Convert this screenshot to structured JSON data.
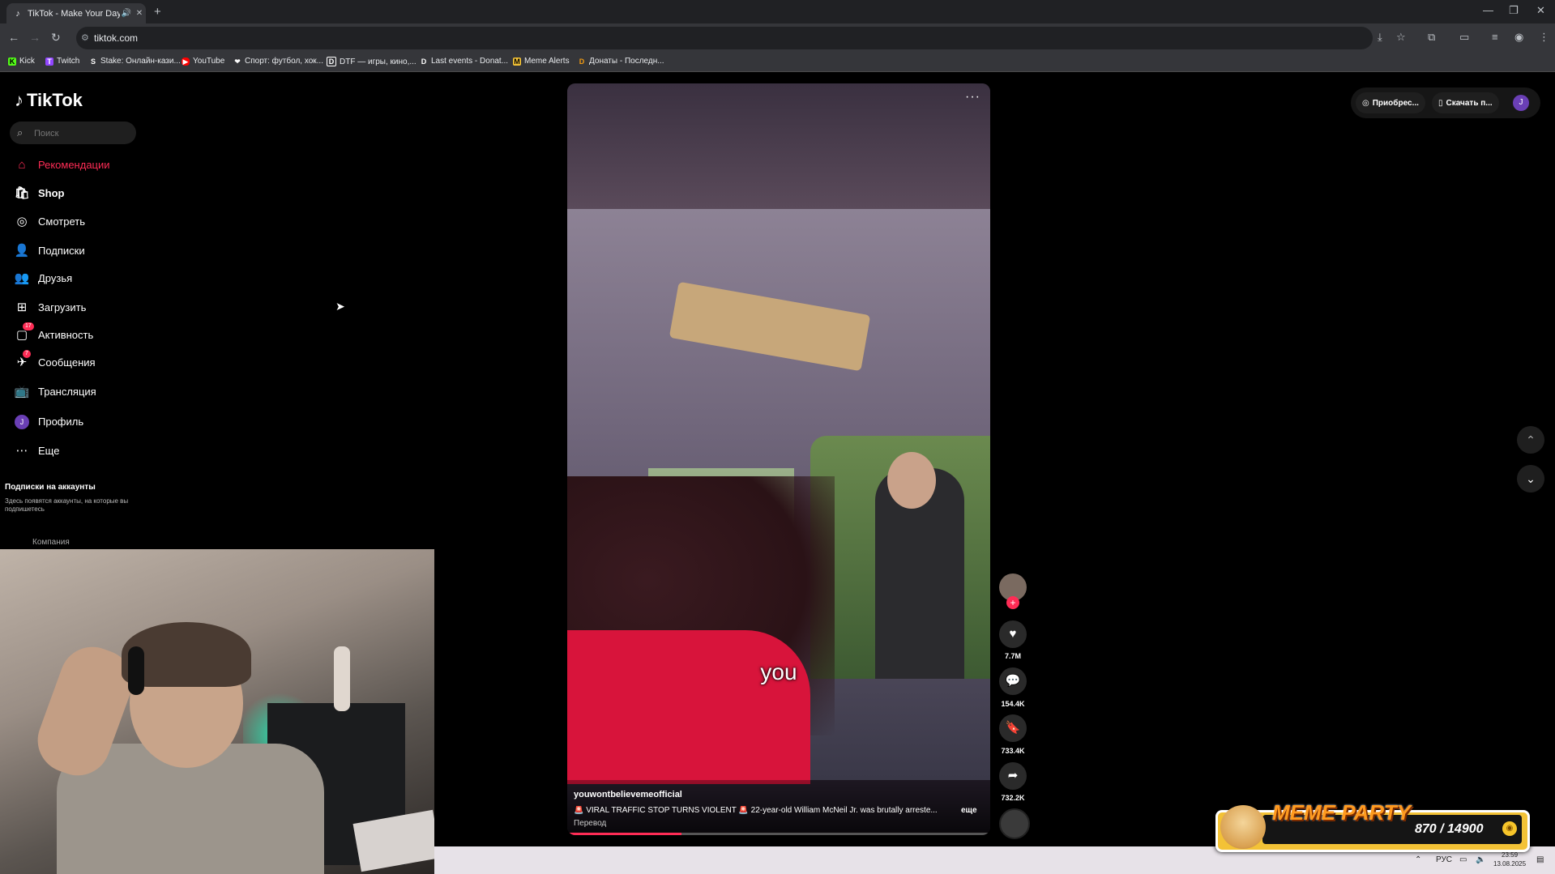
{
  "browser": {
    "tab_title": "TikTok - Make Your Day",
    "url": "tiktok.com",
    "bookmarks": [
      {
        "label": "Kick",
        "icon": "kick-icon",
        "color": "#53fc18"
      },
      {
        "label": "Twitch",
        "icon": "twitch-icon",
        "color": "#9146ff"
      },
      {
        "label": "Stake: Онлайн-кази...",
        "icon": "stake-icon",
        "color": "#ffffff"
      },
      {
        "label": "YouTube",
        "icon": "youtube-icon",
        "color": "#ff0000"
      },
      {
        "label": "Спорт: футбол, хок...",
        "icon": "sport-icon",
        "color": "#ffffff"
      },
      {
        "label": "DTF — игры, кино,...",
        "icon": "dtf-icon",
        "color": "#ffffff"
      },
      {
        "label": "Last events - Donat...",
        "icon": "donat-icon",
        "color": "#ffffff"
      },
      {
        "label": "Meme Alerts",
        "icon": "meme-alerts-icon",
        "color": "#f3c236"
      },
      {
        "label": "Донаты - Последн...",
        "icon": "donate-icon",
        "color": "#f39c12"
      }
    ]
  },
  "tiktok": {
    "logo": "TikTok",
    "search_placeholder": "Поиск",
    "nav": [
      {
        "label": "Рекомендации",
        "icon": "home-icon",
        "active": true
      },
      {
        "label": "Shop",
        "icon": "shop-icon"
      },
      {
        "label": "Смотреть",
        "icon": "explore-icon"
      },
      {
        "label": "Подписки",
        "icon": "following-icon"
      },
      {
        "label": "Друзья",
        "icon": "friends-icon"
      },
      {
        "label": "Загрузить",
        "icon": "upload-icon"
      },
      {
        "label": "Активность",
        "icon": "activity-icon",
        "badge": "17"
      },
      {
        "label": "Сообщения",
        "icon": "messages-icon",
        "badge": "7"
      },
      {
        "label": "Трансляция",
        "icon": "live-icon"
      },
      {
        "label": "Профиль",
        "icon": "profile-avatar",
        "avatar": "J"
      },
      {
        "label": "Еще",
        "icon": "more-icon"
      }
    ],
    "following_header": "Подписки на аккаунты",
    "following_subtext": "Здесь появятся аккаунты, на которые вы подпишетесь",
    "company": "Компания",
    "top_buttons": {
      "get_coins": "Приобрес...",
      "download": "Скачать п...",
      "user_initial": "J"
    }
  },
  "video": {
    "subtitle": "you",
    "author": "youwontbelievemeofficial",
    "caption": "🚨 VIRAL TRAFFIC STOP TURNS VIOLENT 🚨 22-year-old William McNeil Jr. was brutally arreste...",
    "caption_more": "еще",
    "translate": "Перевод",
    "progress": 0.27,
    "likes": "7.7M",
    "comments": "154.4K",
    "saves": "733.4K",
    "shares": "732.2K"
  },
  "meme_widget": {
    "title": "MEME PARTY",
    "count": "870 / 14900"
  },
  "taskbar": {
    "lang": "РУС",
    "time": "23:59",
    "date": "13.08.2025"
  }
}
